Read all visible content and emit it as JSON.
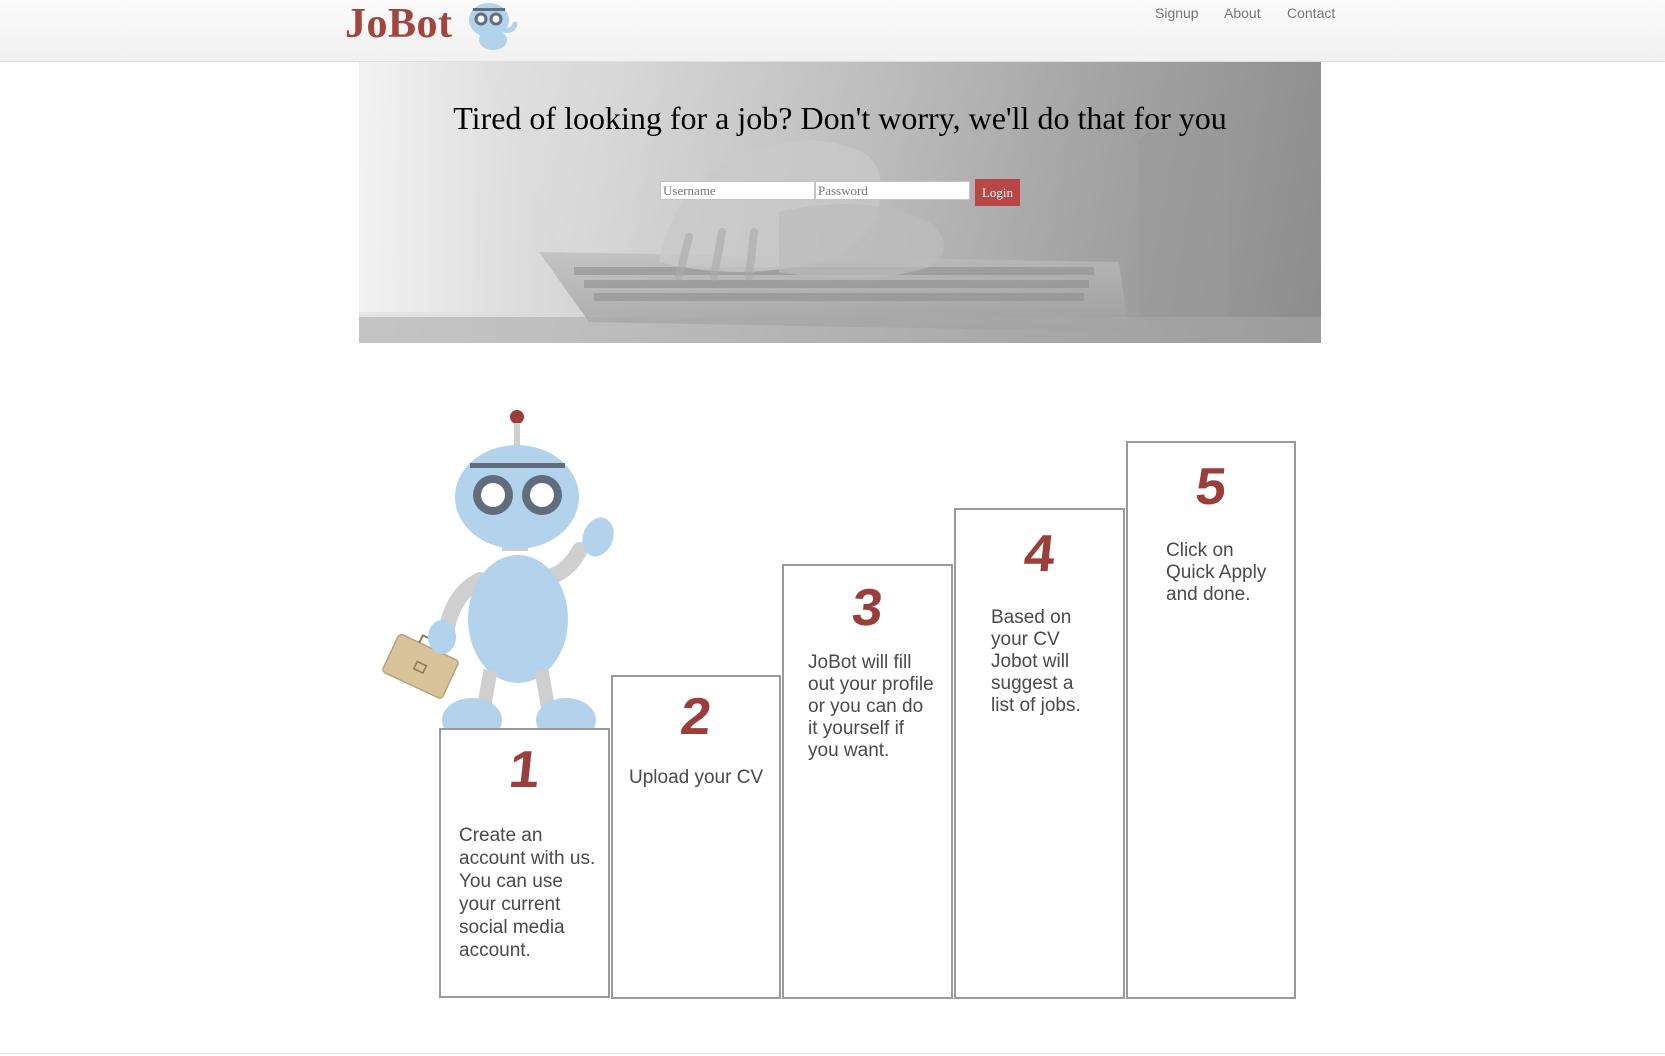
{
  "header": {
    "logo": "JoBot",
    "nav": {
      "signup": "Signup",
      "about": "About",
      "contact": "Contact"
    }
  },
  "hero": {
    "title": "Tired of looking for a job? Don't worry, we'll do that for you",
    "username_placeholder": "Username",
    "password_placeholder": "Password",
    "login_label": "Login"
  },
  "steps": [
    {
      "number": "1",
      "text": "Create an account with us. You can use your current social media account."
    },
    {
      "number": "2",
      "text": "Upload your CV"
    },
    {
      "number": "3",
      "text": "JoBot will fill out your profile or you can do it yourself if you want."
    },
    {
      "number": "4",
      "text": "Based on your CV Jobot will suggest a list of jobs."
    },
    {
      "number": "5",
      "text": "Click on Quick Apply and done."
    }
  ],
  "colors": {
    "brand": "#a2453f",
    "button": "#b94646",
    "robot": "#b3d3ec"
  }
}
